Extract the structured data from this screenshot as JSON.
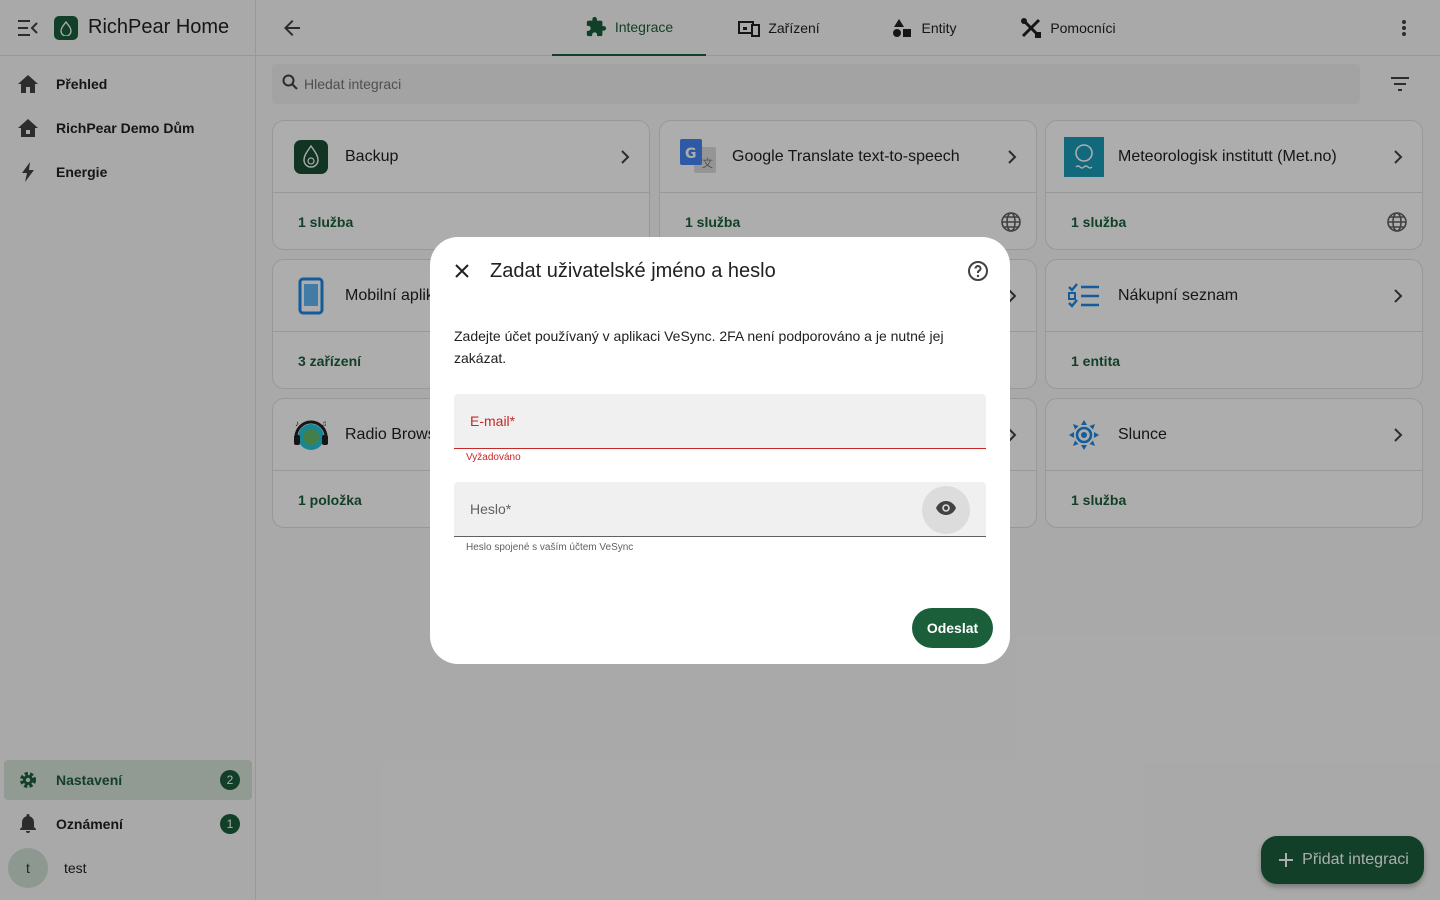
{
  "app": {
    "title": "RichPear Home"
  },
  "sidebar": {
    "items": [
      {
        "label": "Přehled",
        "icon": "home-icon"
      },
      {
        "label": "RichPear Demo Dům",
        "icon": "home-outline-icon"
      },
      {
        "label": "Energie",
        "icon": "lightning-icon"
      }
    ],
    "bottom": [
      {
        "label": "Nastavení",
        "icon": "gear-icon",
        "badge": "2",
        "active": true
      },
      {
        "label": "Oznámení",
        "icon": "bell-icon",
        "badge": "1"
      }
    ],
    "user": {
      "initial": "t",
      "name": "test"
    }
  },
  "tabs": [
    {
      "label": "Integrace",
      "icon": "puzzle-icon",
      "active": true
    },
    {
      "label": "Zařízení",
      "icon": "devices-icon"
    },
    {
      "label": "Entity",
      "icon": "shapes-icon"
    },
    {
      "label": "Pomocníci",
      "icon": "tools-icon"
    }
  ],
  "search": {
    "placeholder": "Hledat integraci"
  },
  "cards": [
    {
      "name": "Backup",
      "footer": "1 služba",
      "icon": "backup-logo-icon"
    },
    {
      "name": "Google Translate text-to-speech",
      "footer": "1 služba",
      "icon": "google-translate-icon",
      "globe": true
    },
    {
      "name": "Meteorologisk institutt (Met.no)",
      "footer": "1 služba",
      "icon": "met-no-icon",
      "globe": true
    },
    {
      "name": "Mobilní aplik",
      "footer": "3 zařízení",
      "icon": "phone-icon"
    },
    {
      "name": "Nákupní seznam",
      "footer": "1 entita",
      "icon": "checklist-icon"
    },
    {
      "name": "Radio Brows",
      "footer": "1 položka",
      "icon": "radio-browser-icon"
    },
    {
      "name": "Slunce",
      "footer": "1 služba",
      "icon": "sun-icon"
    }
  ],
  "fab": {
    "label": "Přidat integraci"
  },
  "dialog": {
    "title": "Zadat uživatelské jméno a heslo",
    "description": "Zadejte účet používaný v aplikaci VeSync. 2FA není podporováno a je nutné jej zakázat.",
    "email": {
      "label": "E-mail*",
      "value": "",
      "error": "Vyžadováno"
    },
    "password": {
      "label": "Heslo*",
      "value": "",
      "helper": "Heslo spojené s vaším účtem VeSync"
    },
    "submit_label": "Odeslat"
  },
  "colors": {
    "primary": "#1b5e3a",
    "error": "#c62828",
    "active_bg": "#d6e5da"
  }
}
